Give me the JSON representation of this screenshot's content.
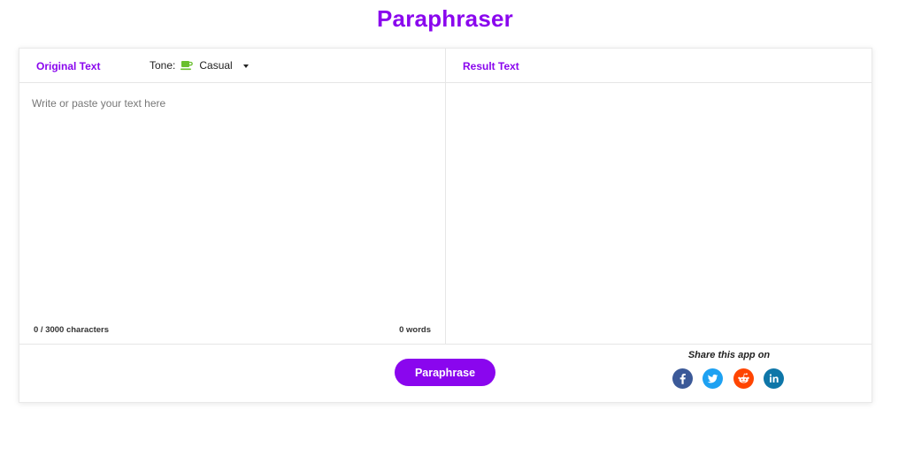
{
  "app": {
    "title": "Paraphraser"
  },
  "left_pane": {
    "header_label": "Original Text",
    "tone": {
      "label": "Tone:",
      "selected": "Casual",
      "icon": "coffee-cup-icon"
    },
    "input": {
      "value": "",
      "placeholder": "Write or paste your text here"
    },
    "char_count": "0 / 3000 characters",
    "word_count": "0 words"
  },
  "right_pane": {
    "header_label": "Result Text",
    "output": ""
  },
  "actions": {
    "paraphrase_label": "Paraphrase"
  },
  "share": {
    "label": "Share this app on",
    "networks": [
      {
        "name": "Facebook",
        "icon": "facebook-icon",
        "color": "#3b5998"
      },
      {
        "name": "Twitter",
        "icon": "twitter-icon",
        "color": "#1da1f2"
      },
      {
        "name": "Reddit",
        "icon": "reddit-icon",
        "color": "#ff4500"
      },
      {
        "name": "LinkedIn",
        "icon": "linkedin-icon",
        "color": "#0e76a8"
      }
    ]
  },
  "colors": {
    "accent": "#8a06ee",
    "tone_icon": "#6abf2e"
  }
}
